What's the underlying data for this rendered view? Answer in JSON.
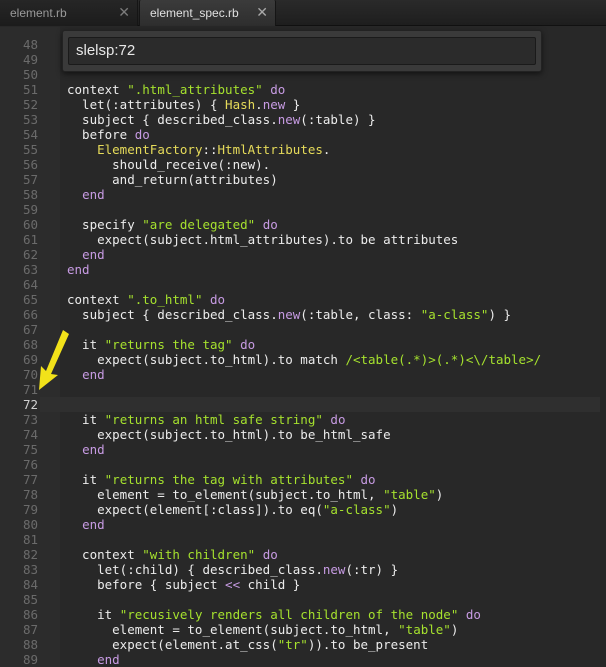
{
  "tabs": [
    {
      "label": "element.rb",
      "close": "✕"
    },
    {
      "label": "element_spec.rb",
      "close": "✕"
    }
  ],
  "goto": {
    "value": "slelsp:72"
  },
  "current_line": "72",
  "lines": [
    {
      "n": "48",
      "html": ""
    },
    {
      "n": "49",
      "html": ""
    },
    {
      "n": "50",
      "html": ""
    },
    {
      "n": "51",
      "html": "<span class='sym'>context </span><span class='str'>\".html_attributes\"</span><span class='kw'> do</span>"
    },
    {
      "n": "52",
      "html": "  let(:attributes) { <span class='cls'>Hash</span>.<span class='kw'>new</span> }"
    },
    {
      "n": "53",
      "html": "  subject { described_class.<span class='kw'>new</span>(:table) }"
    },
    {
      "n": "54",
      "html": "  before <span class='kw'>do</span>"
    },
    {
      "n": "55",
      "html": "    <span class='cls'>ElementFactory</span>::<span class='cls'>HtmlAttributes</span>."
    },
    {
      "n": "56",
      "html": "      should_receive(:new)."
    },
    {
      "n": "57",
      "html": "      and_return(attributes)"
    },
    {
      "n": "58",
      "html": "  <span class='kw'>end</span>"
    },
    {
      "n": "59",
      "html": ""
    },
    {
      "n": "60",
      "html": "  specify <span class='str'>\"are delegated\"</span> <span class='kw'>do</span>"
    },
    {
      "n": "61",
      "html": "    expect(subject.html_attributes).to be attributes"
    },
    {
      "n": "62",
      "html": "  <span class='kw'>end</span>"
    },
    {
      "n": "63",
      "html": "<span class='kw'>end</span>"
    },
    {
      "n": "64",
      "html": ""
    },
    {
      "n": "65",
      "html": "context <span class='str'>\".to_html\"</span> <span class='kw'>do</span>"
    },
    {
      "n": "66",
      "html": "  subject { described_class.<span class='kw'>new</span>(:table, class: <span class='str'>\"a-class\"</span>) }"
    },
    {
      "n": "67",
      "html": ""
    },
    {
      "n": "68",
      "html": "  it <span class='str'>\"returns the tag\"</span> <span class='kw'>do</span>"
    },
    {
      "n": "69",
      "html": "    expect(subject.to_html).to match <span class='str'>/&lt;table(.*)&gt;(.*)&lt;\\/table&gt;/</span>"
    },
    {
      "n": "70",
      "html": "  <span class='kw'>end</span>"
    },
    {
      "n": "71",
      "html": ""
    },
    {
      "n": "72",
      "html": ""
    },
    {
      "n": "73",
      "html": "  it <span class='str'>\"returns an html safe string\"</span> <span class='kw'>do</span>"
    },
    {
      "n": "74",
      "html": "    expect(subject.to_html).to be_html_safe"
    },
    {
      "n": "75",
      "html": "  <span class='kw'>end</span>"
    },
    {
      "n": "76",
      "html": ""
    },
    {
      "n": "77",
      "html": "  it <span class='str'>\"returns the tag with attributes\"</span> <span class='kw'>do</span>"
    },
    {
      "n": "78",
      "html": "    element = to_element(subject.to_html, <span class='str'>\"table\"</span>)"
    },
    {
      "n": "79",
      "html": "    expect(element[:class]).to eq(<span class='str'>\"a-class\"</span>)"
    },
    {
      "n": "80",
      "html": "  <span class='kw'>end</span>"
    },
    {
      "n": "81",
      "html": ""
    },
    {
      "n": "82",
      "html": "  context <span class='str'>\"with children\"</span> <span class='kw'>do</span>"
    },
    {
      "n": "83",
      "html": "    let(:child) { described_class.<span class='kw'>new</span>(:tr) }"
    },
    {
      "n": "84",
      "html": "    before { subject <span class='kw'>&lt;&lt;</span> child }"
    },
    {
      "n": "85",
      "html": ""
    },
    {
      "n": "86",
      "html": "    it <span class='str'>\"recusively renders all children of the node\"</span> <span class='kw'>do</span>"
    },
    {
      "n": "87",
      "html": "      element = to_element(subject.to_html, <span class='str'>\"table\"</span>)"
    },
    {
      "n": "88",
      "html": "      expect(element.at_css(<span class='str'>\"tr\"</span>)).to be_present"
    },
    {
      "n": "89",
      "html": "    <span class='kw'>end</span>"
    }
  ]
}
